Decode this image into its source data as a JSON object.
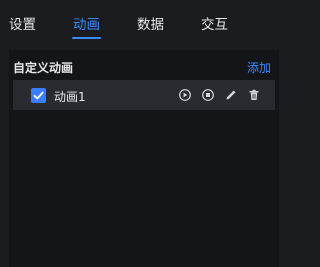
{
  "tabs": [
    {
      "label": "设置",
      "active": false
    },
    {
      "label": "动画",
      "active": true
    },
    {
      "label": "数据",
      "active": false
    },
    {
      "label": "交互",
      "active": false
    }
  ],
  "section": {
    "title": "自定义动画",
    "add_label": "添加"
  },
  "animations": [
    {
      "name": "动画1",
      "checked": true,
      "actions": [
        "play-icon",
        "stop-icon",
        "edit-icon",
        "delete-icon"
      ]
    }
  ],
  "colors": {
    "accent": "#3a8bff",
    "background": "#1b1c20",
    "content_background": "#141519",
    "row_background": "#2a2b30",
    "text": "#e8e8ea"
  }
}
